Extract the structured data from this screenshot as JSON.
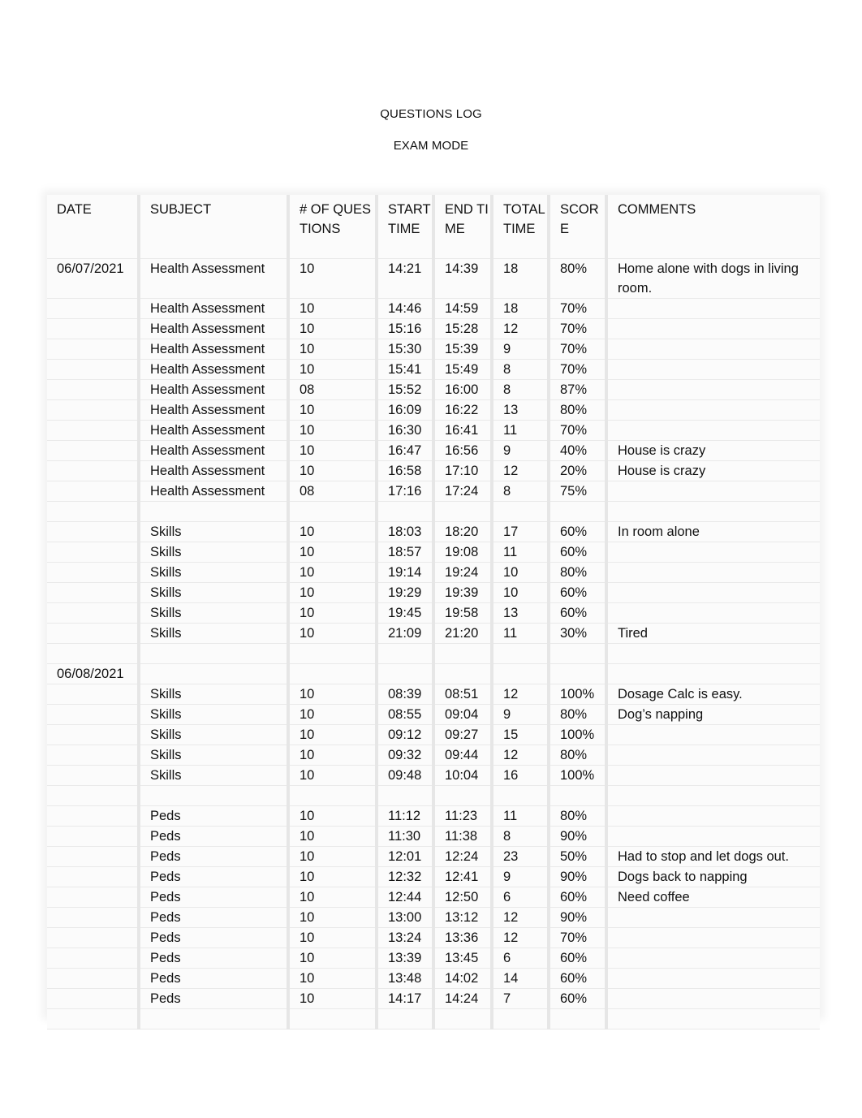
{
  "document": {
    "title": "QUESTIONS LOG",
    "subtitle": "EXAM MODE"
  },
  "table": {
    "headers": [
      "DATE",
      "SUBJECT",
      "# OF QUESTIONS",
      "START TIME",
      "END TIME",
      "TOTAL TIME",
      "SCORE",
      "COMMENTS"
    ],
    "rows": [
      [
        "06/07/2021",
        "Health Assessment",
        "10",
        "14:21",
        "14:39",
        "18",
        "80%",
        "Home alone with dogs in living room."
      ],
      [
        "",
        "Health Assessment",
        "10",
        "14:46",
        "14:59",
        "18",
        "70%",
        ""
      ],
      [
        "",
        "Health Assessment",
        "10",
        "15:16",
        "15:28",
        "12",
        "70%",
        ""
      ],
      [
        "",
        "Health Assessment",
        "10",
        "15:30",
        "15:39",
        "9",
        "70%",
        ""
      ],
      [
        "",
        "Health Assessment",
        "10",
        "15:41",
        "15:49",
        "8",
        "70%",
        ""
      ],
      [
        "",
        "Health Assessment",
        "08",
        "15:52",
        "16:00",
        "8",
        "87%",
        ""
      ],
      [
        "",
        "Health Assessment",
        "10",
        "16:09",
        "16:22",
        "13",
        "80%",
        ""
      ],
      [
        "",
        "Health Assessment",
        "10",
        "16:30",
        "16:41",
        "11",
        "70%",
        ""
      ],
      [
        "",
        "Health Assessment",
        "10",
        "16:47",
        "16:56",
        "9",
        "40%",
        "House is crazy"
      ],
      [
        "",
        "Health Assessment",
        "10",
        "16:58",
        "17:10",
        "12",
        "20%",
        "House is crazy"
      ],
      [
        "",
        "Health Assessment",
        "08",
        "17:16",
        "17:24",
        "8",
        "75%",
        ""
      ],
      [
        "",
        "",
        "",
        "",
        "",
        "",
        "",
        ""
      ],
      [
        "",
        "Skills",
        "10",
        "18:03",
        "18:20",
        "17",
        "60%",
        "In room alone"
      ],
      [
        "",
        "Skills",
        "10",
        "18:57",
        "19:08",
        "11",
        "60%",
        ""
      ],
      [
        "",
        "Skills",
        "10",
        "19:14",
        "19:24",
        "10",
        "80%",
        ""
      ],
      [
        "",
        "Skills",
        "10",
        "19:29",
        "19:39",
        "10",
        "60%",
        ""
      ],
      [
        "",
        "Skills",
        "10",
        "19:45",
        "19:58",
        "13",
        "60%",
        ""
      ],
      [
        "",
        "Skills",
        "10",
        "21:09",
        "21:20",
        "11",
        "30%",
        "Tired"
      ],
      [
        "",
        "",
        "",
        "",
        "",
        "",
        "",
        ""
      ],
      [
        "06/08/2021",
        "",
        "",
        "",
        "",
        "",
        "",
        ""
      ],
      [
        "",
        "Skills",
        "10",
        "08:39",
        "08:51",
        "12",
        "100%",
        "Dosage Calc is easy."
      ],
      [
        "",
        "Skills",
        "10",
        "08:55",
        "09:04",
        "9",
        "80%",
        "Dog’s napping"
      ],
      [
        "",
        "Skills",
        "10",
        "09:12",
        "09:27",
        "15",
        "100%",
        ""
      ],
      [
        "",
        "Skills",
        "10",
        "09:32",
        "09:44",
        "12",
        "80%",
        ""
      ],
      [
        "",
        "Skills",
        "10",
        "09:48",
        "10:04",
        "16",
        "100%",
        ""
      ],
      [
        "",
        "",
        "",
        "",
        "",
        "",
        "",
        ""
      ],
      [
        "",
        "Peds",
        "10",
        "11:12",
        "11:23",
        "11",
        "80%",
        ""
      ],
      [
        "",
        "Peds",
        "10",
        "11:30",
        "11:38",
        "8",
        "90%",
        ""
      ],
      [
        "",
        "Peds",
        "10",
        "12:01",
        "12:24",
        "23",
        "50%",
        "Had to stop and let dogs out."
      ],
      [
        "",
        "Peds",
        "10",
        "12:32",
        "12:41",
        "9",
        "90%",
        "Dogs back to napping"
      ],
      [
        "",
        "Peds",
        "10",
        "12:44",
        "12:50",
        "6",
        "60%",
        "Need coffee"
      ],
      [
        "",
        "Peds",
        "10",
        "13:00",
        "13:12",
        "12",
        "90%",
        ""
      ],
      [
        "",
        "Peds",
        "10",
        "13:24",
        "13:36",
        "12",
        "70%",
        ""
      ],
      [
        "",
        "Peds",
        "10",
        "13:39",
        "13:45",
        "6",
        "60%",
        ""
      ],
      [
        "",
        "Peds",
        "10",
        "13:48",
        "14:02",
        "14",
        "60%",
        ""
      ],
      [
        "",
        "Peds",
        "10",
        "14:17",
        "14:24",
        "7",
        "60%",
        ""
      ],
      [
        "",
        "",
        "",
        "",
        "",
        "",
        "",
        ""
      ]
    ]
  }
}
